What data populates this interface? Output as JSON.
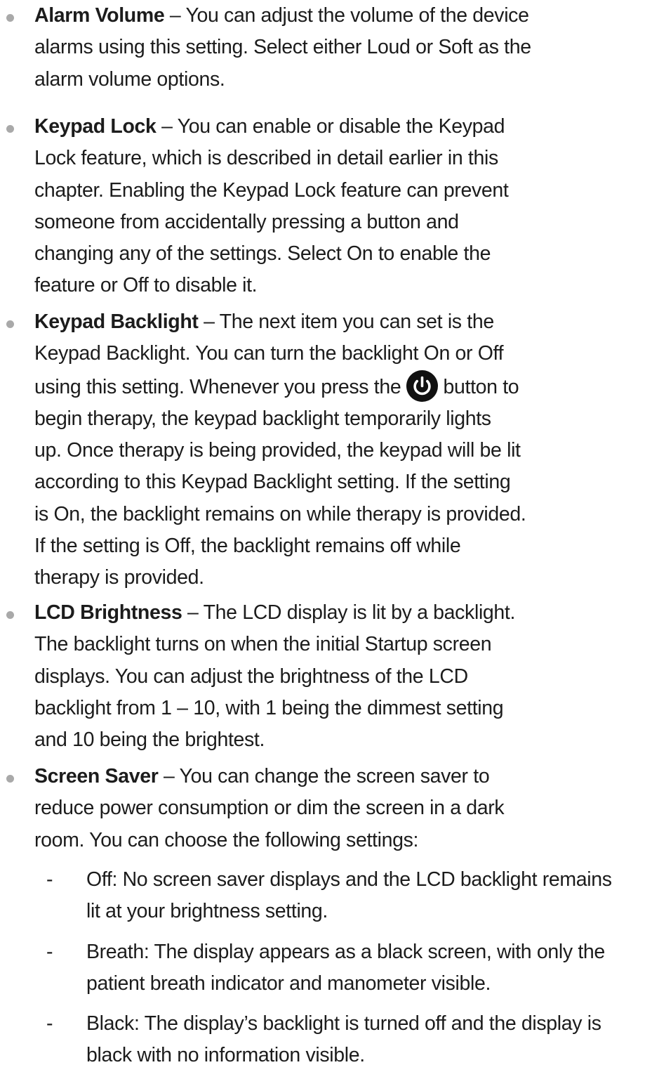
{
  "items": [
    {
      "term": "Alarm Volume",
      "lines": [
        " – You can adjust the volume of the device",
        "alarms using this setting. Select either Loud or Soft as the",
        "alarm volume options."
      ]
    },
    {
      "term": "Keypad Lock",
      "lines": [
        " – You can enable or disable the Keypad",
        "Lock feature, which is described in detail earlier in this",
        "chapter. Enabling the Keypad Lock feature can prevent",
        "someone from accidentally pressing a button and",
        "changing any of the settings.  Select On to enable the",
        "feature or Off to disable it."
      ]
    },
    {
      "term": "Keypad Backlight",
      "lines": [
        " – The next item you can set is the",
        "Keypad Backlight. You can turn the backlight On or Off",
        "using this setting. Whenever you press the",
        "button to",
        "begin therapy, the keypad backlight temporarily lights",
        "up. Once therapy is being provided, the keypad will be lit",
        "according to this Keypad Backlight setting.  If the setting",
        "is On, the backlight remains on while therapy is provided.",
        "If the setting is Off, the backlight remains off while",
        "therapy is provided."
      ],
      "icon": "power-icon"
    },
    {
      "term": "LCD Brightness",
      "lines": [
        " – The LCD display is lit by a backlight.",
        "The backlight turns on when the initial Startup screen",
        "displays. You can adjust the brightness of the LCD",
        "backlight from 1 – 10, with 1 being the dimmest setting",
        "and 10 being the brightest."
      ]
    },
    {
      "term": "Screen Saver",
      "lines": [
        " – You can change the screen saver to",
        "reduce power consumption or dim the screen in a dark",
        "room. You can choose the following settings:"
      ],
      "subitems": [
        {
          "dash": "-",
          "lines": [
            "Off: No screen saver displays and the LCD backlight remains",
            "lit at your brightness setting."
          ]
        },
        {
          "dash": "-",
          "lines": [
            "Breath: The display appears as a black screen, with only the",
            "patient breath indicator and manometer visible."
          ]
        },
        {
          "dash": "-",
          "lines": [
            "Black: The display’s backlight is turned off and the display is",
            "black with no information visible."
          ]
        }
      ]
    }
  ]
}
